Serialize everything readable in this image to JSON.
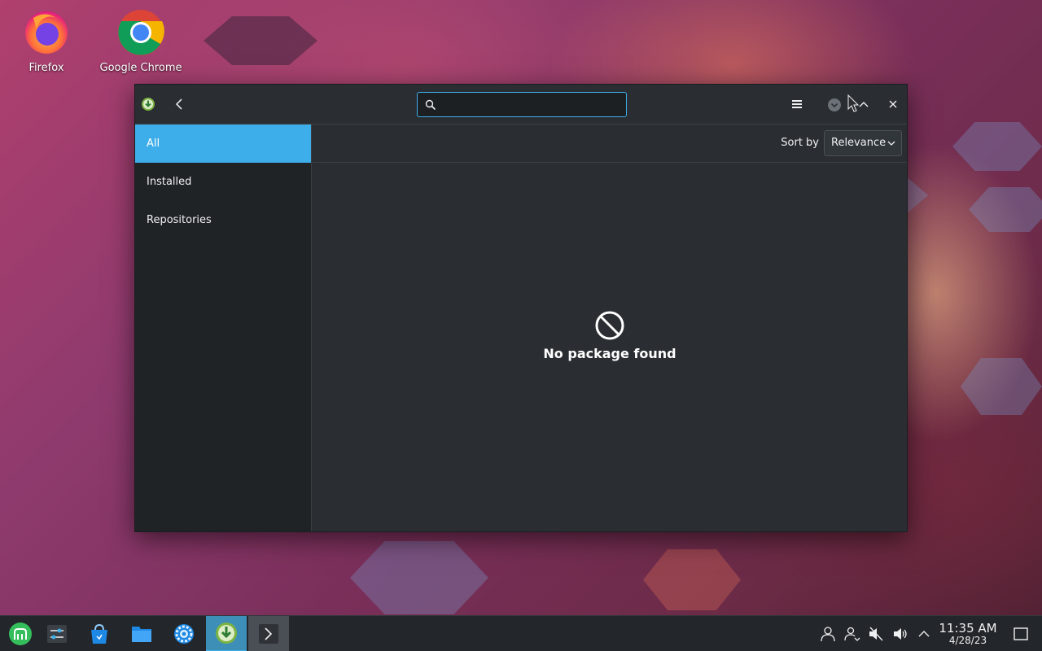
{
  "desktop": {
    "icons": [
      {
        "label": "Firefox"
      },
      {
        "label": "Google Chrome"
      }
    ]
  },
  "window": {
    "search": {
      "value": "",
      "placeholder": ""
    },
    "sidebar": {
      "items": [
        {
          "label": "All",
          "active": true
        },
        {
          "label": "Installed",
          "active": false
        },
        {
          "label": "Repositories",
          "active": false
        }
      ]
    },
    "sort": {
      "label": "Sort by",
      "selected": "Relevance"
    },
    "empty_state": {
      "message": "No package found"
    }
  },
  "taskbar": {
    "clock": {
      "time": "11:35 AM",
      "date": "4/28/23"
    }
  },
  "colors": {
    "accent": "#3daee9",
    "window_bg": "#2a2e32",
    "sidebar_bg": "#202326",
    "taskbar_bg": "#23262a"
  }
}
